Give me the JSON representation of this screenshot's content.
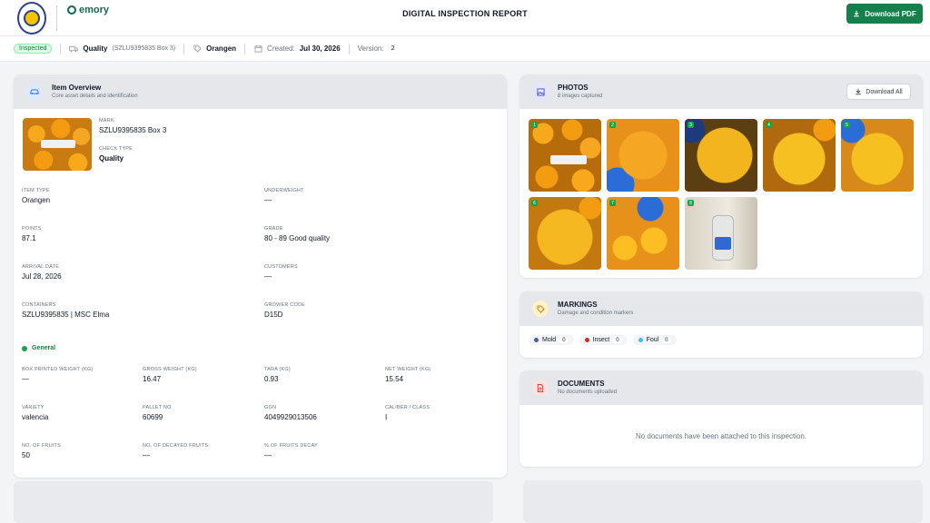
{
  "header": {
    "title": "DIGITAL INSPECTION REPORT",
    "download_pdf_label": "Download PDF",
    "brand_name": "emory"
  },
  "meta": {
    "status_badge": "Inspected",
    "check_type": "Quality",
    "check_ref": "(SZLU9395835 Box 3)",
    "item": "Orangen",
    "created_label": "Created:",
    "created_date": "Jul 30, 2026",
    "version_label": "Version:",
    "version_value": "2"
  },
  "overview": {
    "title": "Item Overview",
    "subtitle": "Core asset details and identification",
    "mark_label": "MARK",
    "mark_value": "SZLU9395835 Box 3",
    "check_type_label": "CHECK TYPE",
    "check_type_value": "Quality",
    "fields": [
      {
        "label": "ITEM TYPE",
        "value": "Orangen"
      },
      {
        "label": "UNDERWEIGHT",
        "value": "—"
      },
      {
        "label": "POINTS",
        "value": "87.1"
      },
      {
        "label": "GRADE",
        "value": "80 - 89 Good quality"
      },
      {
        "label": "ARRIVAL DATE",
        "value": "Jul 28, 2026"
      },
      {
        "label": "CUSTOMERS",
        "value": "—"
      },
      {
        "label": "CONTAINERS",
        "value": "SZLU9395835 | MSC Elma"
      },
      {
        "label": "GROWER CODE",
        "value": "D15D"
      }
    ],
    "general_label": "General",
    "general_fields": [
      {
        "label": "BOX PRINTED WEIGHT (KG)",
        "value": "—"
      },
      {
        "label": "GROSS WEIGHT (KG)",
        "value": "16.47"
      },
      {
        "label": "TARA (KG)",
        "value": "0.93"
      },
      {
        "label": "NET WEIGHT (KG)",
        "value": "15.54"
      },
      {
        "label": "VARIETY",
        "value": "valencia"
      },
      {
        "label": "PALLET NO",
        "value": "60699"
      },
      {
        "label": "GGN",
        "value": "4049929013506"
      },
      {
        "label": "CALIBER / CLASS",
        "value": "I"
      },
      {
        "label": "NO. OF FRUITS",
        "value": "50"
      },
      {
        "label": "NO. OF DECAYED FRUITS",
        "value": "—"
      },
      {
        "label": "% OF FRUITS DECAY",
        "value": "—"
      }
    ]
  },
  "photos": {
    "title": "PHOTOS",
    "subtitle": "8 images captured",
    "download_all_label": "Download All",
    "numbers": [
      "1",
      "2",
      "3",
      "4",
      "5",
      "6",
      "7",
      "8"
    ]
  },
  "markings": {
    "title": "MARKINGS",
    "subtitle": "Damage and condition markers",
    "items": [
      {
        "name": "Mold",
        "count": "0",
        "color": "#4b5ea8"
      },
      {
        "name": "Insect",
        "count": "0",
        "color": "#dc2626"
      },
      {
        "name": "Foul",
        "count": "0",
        "color": "#38bdf8"
      }
    ]
  },
  "documents": {
    "title": "DOCUMENTS",
    "subtitle": "No documents uploaded",
    "empty_text": "No documents have been attached to this inspection."
  },
  "colors": {
    "accent_green": "#16804c",
    "header_gray": "#e5e7eb"
  }
}
